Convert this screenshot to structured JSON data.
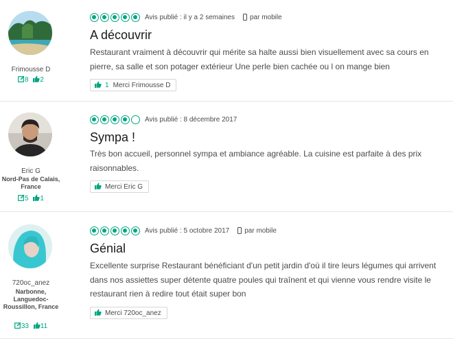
{
  "reviews": [
    {
      "username": "Frimousse D",
      "location": "",
      "contributions": "8",
      "helpful_votes": "2",
      "rating": 5,
      "published": "Avis publié : il y a 2 semaines",
      "mobile_label": "par mobile",
      "title": "A découvrir",
      "body": "Restaurant vraiment à découvrir qui mérite sa halte aussi bien visuellement avec sa cours en pierre, sa salle et son potager extérieur Une perle bien cachée ou l on mange bien",
      "thanks_count": "1",
      "thanks_label": "Merci Frimousse D"
    },
    {
      "username": "Eric G",
      "location": "Nord-Pas de Calais, France",
      "contributions": "5",
      "helpful_votes": "1",
      "rating": 4,
      "published": "Avis publié : 8 décembre 2017",
      "mobile_label": "",
      "title": "Sympa !",
      "body": "Très bon accueil, personnel sympa et ambiance agréable. La cuisine est parfaite à des prix raisonnables.",
      "thanks_count": "",
      "thanks_label": "Merci Eric G"
    },
    {
      "username": "720oc_anez",
      "location": "Narbonne, Languedoc-Roussillon, France",
      "contributions": "33",
      "helpful_votes": "11",
      "rating": 5,
      "published": "Avis publié : 5 octobre 2017",
      "mobile_label": "par mobile",
      "title": "Génial",
      "body": "Excellente surprise Restaurant bénéficiant d'un petit jardin d'où il tire leurs légumes qui arrivent dans nos assiettes super détente quatre poules qui traînent et qui vienne vous rendre visite le restaurant rien à redire tout était super bon",
      "thanks_count": "",
      "thanks_label": "Merci 720oc_anez"
    }
  ],
  "colors": {
    "accent": "#00a680",
    "text": "#4a4a4a",
    "title": "#1a1a1a",
    "divider": "#e5e5e5"
  },
  "icons": {
    "rating": "bubble-rating-icon",
    "mobile": "phone-icon",
    "contributions": "pencil-icon",
    "votes": "thumbs-up-icon"
  }
}
